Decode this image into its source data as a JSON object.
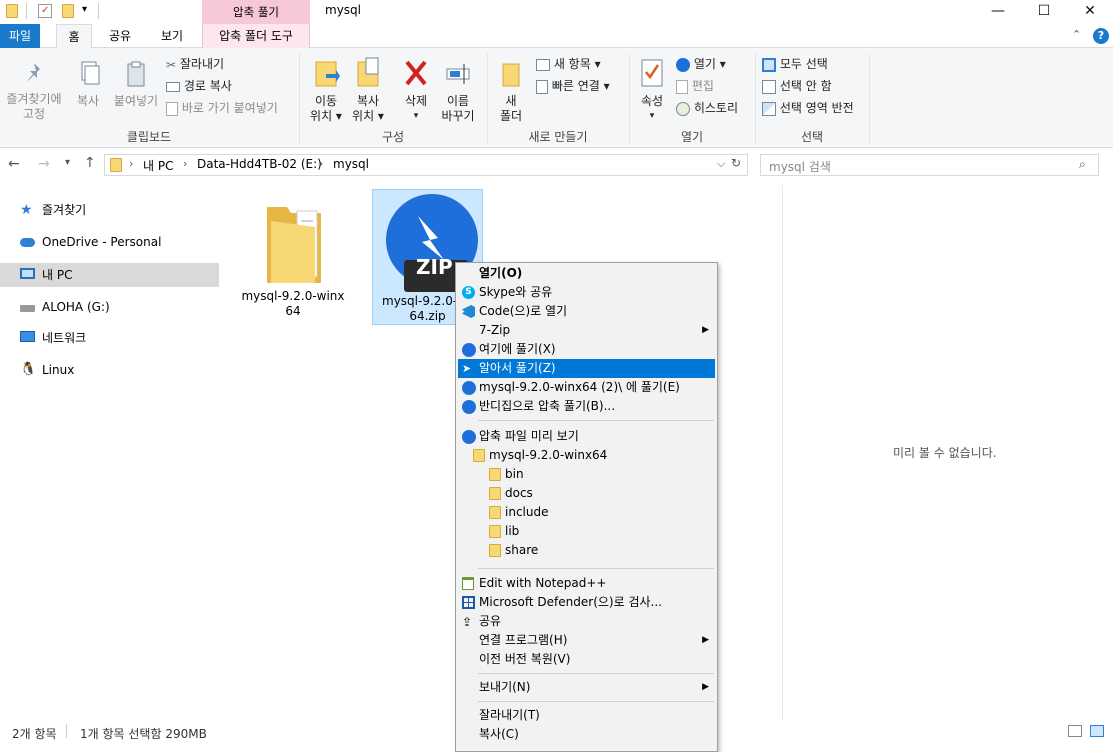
{
  "title_bar": {
    "tool_tab_header": "압축 풀기",
    "window_title": "mysql",
    "controls": [
      "—",
      "☐",
      "✕"
    ]
  },
  "ribbon_tabs": {
    "file": "파일",
    "home": "홈",
    "share": "공유",
    "view": "보기",
    "tool": "압축 폴더 도구"
  },
  "ribbon": {
    "clipboard": {
      "pin": [
        "즐겨찾기에",
        "고정"
      ],
      "copy": "복사",
      "paste": "붙여넣기",
      "cut": "잘라내기",
      "copy_path": "경로 복사",
      "paste_shortcut": "바로 가기 붙여넣기",
      "group_label": "클립보드"
    },
    "organize": {
      "move_to": [
        "이동",
        "위치 ▾"
      ],
      "copy_to": [
        "복사",
        "위치 ▾"
      ],
      "delete": [
        "삭제",
        "▾"
      ],
      "rename": [
        "이름",
        "바꾸기"
      ],
      "group_label": "구성"
    },
    "new": {
      "new_folder": [
        "새",
        "폴더"
      ],
      "new_item": "새 항목 ▾",
      "easy_access": "빠른 연결 ▾",
      "group_label": "새로 만들기"
    },
    "open": {
      "properties": [
        "속성",
        "▾"
      ],
      "open": "열기 ▾",
      "edit": "편집",
      "history": "히스토리",
      "group_label": "열기"
    },
    "select": {
      "select_all": "모두 선택",
      "select_none": "선택 안 함",
      "invert": "선택 영역 반전",
      "group_label": "선택"
    }
  },
  "address": {
    "crumbs": [
      "내 PC",
      "Data-Hdd4TB-02 (E:)",
      "mysql"
    ],
    "search_placeholder": "mysql 검색"
  },
  "nav_pane": {
    "items": [
      "즐겨찾기",
      "OneDrive - Personal",
      "내 PC",
      "ALOHA (G:)",
      "네트워크",
      "Linux"
    ]
  },
  "files": [
    {
      "name_line1": "mysql-9.2.0-winx",
      "name_line2": "64"
    },
    {
      "name_line1": "mysql-9.2.0-w",
      "name_line2": "64.zip",
      "badge": "ZIP"
    }
  ],
  "preview_text": "미리 볼 수 없습니다.",
  "context_menu": {
    "items": [
      "열기(O)",
      "Skype와 공유",
      "Code(으)로 열기",
      "7-Zip",
      "여기에 풀기(X)",
      "알아서 풀기(Z)",
      "mysql-9.2.0-winx64 (2)\\ 에 풀기(E)",
      "반디집으로 압축 풀기(B)...",
      "압축 파일 미리 보기",
      "mysql-9.2.0-winx64",
      "bin",
      "docs",
      "include",
      "lib",
      "share",
      "Edit with Notepad++",
      "Microsoft Defender(으)로 검사...",
      "공유",
      "연결 프로그램(H)",
      "이전 버전 복원(V)",
      "보내기(N)",
      "잘라내기(T)",
      "복사(C)"
    ]
  },
  "status_bar": {
    "count": "2개 항목",
    "selection": "1개 항목 선택함 290MB"
  },
  "colors": {
    "accent": "#0078d7",
    "file_tab": "#1979ca",
    "tool_tab": "#f5c7d8",
    "selection": "#cce8ff",
    "bandizip_blue": "#1e6fd9"
  }
}
